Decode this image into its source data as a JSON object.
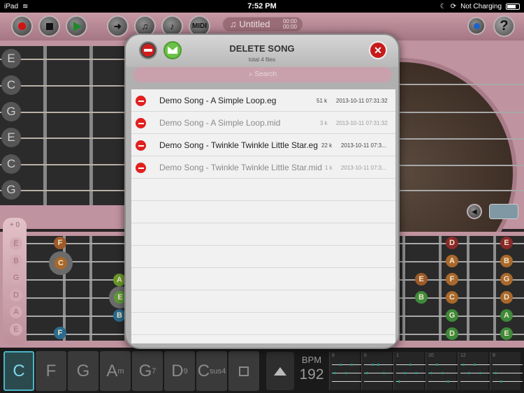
{
  "status": {
    "device": "iPad",
    "time": "7:52 PM",
    "battery": "Not Charging"
  },
  "toolbar": {
    "midi_label": "MIDI",
    "song_title": "Untitled",
    "time_top": "00:00",
    "time_bottom": "00:00",
    "help_label": "?"
  },
  "top_strings": [
    "E",
    "C",
    "G",
    "E",
    "C",
    "G"
  ],
  "lower": {
    "capo": "+ 0",
    "tab_notes": [
      "E",
      "B",
      "G",
      "D",
      "A",
      "E"
    ],
    "left_notes": [
      "F",
      "C",
      "A",
      "E",
      "B",
      "F"
    ],
    "right_notes": [
      "D",
      "A",
      "F",
      "C",
      "G",
      "D",
      "E",
      "B",
      "E",
      "B",
      "G",
      "D",
      "A",
      "E"
    ]
  },
  "modal": {
    "title": "DELETE SONG",
    "subtitle": "total 4 files",
    "search_placeholder": "Search",
    "close_label": "✕",
    "files": [
      {
        "name": "Demo Song - A Simple Loop.eg",
        "size": "51 k",
        "date": "2013-10-11 07:31:32",
        "dim": false
      },
      {
        "name": "Demo Song - A Simple Loop.mid",
        "size": "3 k",
        "date": "2013-10-11 07:31:32",
        "dim": true
      },
      {
        "name": "Demo Song - Twinkle Twinkle Little Star.eg",
        "size": "22 k",
        "date": "2013-10-11 07:3...",
        "dim": false
      },
      {
        "name": "Demo Song - Twinkle Twinkle Little Star.mid",
        "size": "1 k",
        "date": "2013-10-11 07:3...",
        "dim": true
      }
    ]
  },
  "chords": [
    {
      "root": "C",
      "sub": ""
    },
    {
      "root": "F",
      "sub": ""
    },
    {
      "root": "G",
      "sub": ""
    },
    {
      "root": "A",
      "sub": "m"
    },
    {
      "root": "G",
      "sub": "7"
    },
    {
      "root": "D",
      "sub": "9"
    },
    {
      "root": "C",
      "sub": "sus4"
    }
  ],
  "bpm": {
    "label": "BPM",
    "value": "192"
  },
  "patterns": [
    "8",
    "8",
    "1",
    "10",
    "12",
    "8"
  ]
}
